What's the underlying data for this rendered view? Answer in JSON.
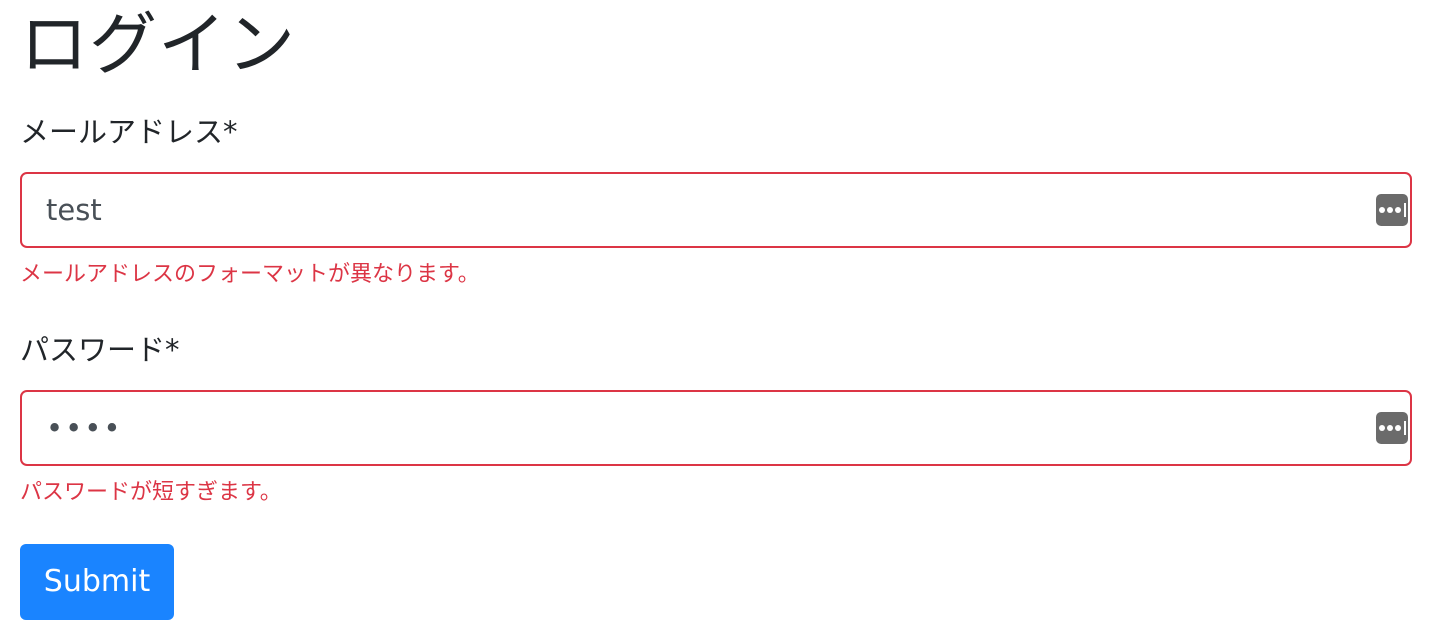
{
  "page": {
    "title": "ログイン"
  },
  "form": {
    "email": {
      "label": "メールアドレス*",
      "value": "test",
      "error": "メールアドレスのフォーマットが異なります。"
    },
    "password": {
      "label": "パスワード*",
      "value": "1234",
      "error": "パスワードが短すぎます。"
    },
    "submit_label": "Submit"
  },
  "icons": {
    "autofill": "password-autofill-key-icon"
  },
  "colors": {
    "error": "#dc3545",
    "primary": "#1a84ff",
    "text": "#212529",
    "autofill_icon": "#6b6b6b"
  }
}
